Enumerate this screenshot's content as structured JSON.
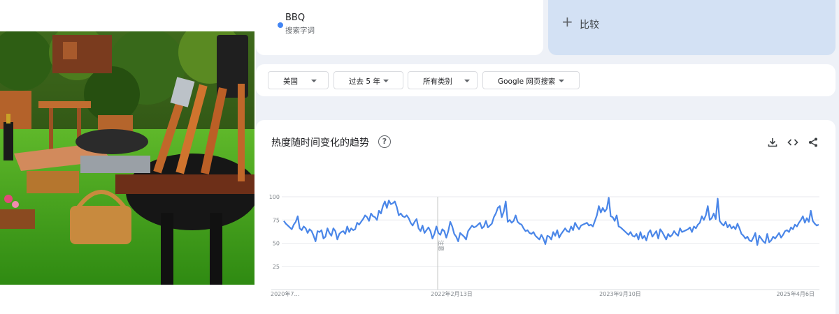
{
  "search_term": {
    "name": "BBQ",
    "type": "搜索字词",
    "color": "#4285f4"
  },
  "compare": {
    "label": "比较"
  },
  "filters": {
    "region": "美国",
    "time": "过去 5 年",
    "category": "所有类别",
    "search_type": "Google 网页搜索"
  },
  "chart_panel": {
    "title": "热度随时间变化的趋势",
    "help": "?",
    "note": "注意"
  },
  "chart_data": {
    "type": "line",
    "title": "热度随时间变化的趋势",
    "xlabel": "",
    "ylabel": "",
    "ylim": [
      0,
      100
    ],
    "y_ticks": [
      25,
      50,
      75,
      100
    ],
    "x_tick_labels": [
      "2020年7…",
      "2022年2月13日",
      "2023年9月10日",
      "2025年4月6日"
    ],
    "grid": true,
    "series": [
      {
        "name": "BBQ",
        "color": "#4a86e8",
        "values": [
          74,
          71,
          69,
          67,
          65,
          70,
          73,
          79,
          66,
          64,
          68,
          66,
          61,
          65,
          63,
          58,
          52,
          63,
          62,
          64,
          55,
          57,
          66,
          61,
          58,
          66,
          63,
          54,
          60,
          62,
          63,
          60,
          68,
          62,
          66,
          64,
          65,
          72,
          70,
          73,
          76,
          80,
          78,
          74,
          82,
          79,
          78,
          75,
          85,
          82,
          90,
          95,
          88,
          96,
          92,
          93,
          95,
          89,
          80,
          82,
          79,
          78,
          80,
          77,
          72,
          69,
          73,
          76,
          66,
          63,
          69,
          61,
          64,
          67,
          63,
          55,
          60,
          68,
          61,
          59,
          65,
          63,
          56,
          63,
          73,
          68,
          60,
          57,
          52,
          61,
          59,
          57,
          54,
          63,
          66,
          69,
          67,
          68,
          70,
          72,
          66,
          68,
          74,
          67,
          69,
          71,
          78,
          82,
          88,
          90,
          78,
          84,
          95,
          73,
          75,
          72,
          74,
          80,
          73,
          71,
          70,
          66,
          63,
          64,
          61,
          60,
          62,
          58,
          56,
          54,
          59,
          55,
          49,
          58,
          57,
          54,
          62,
          58,
          64,
          56,
          60,
          63,
          66,
          63,
          62,
          68,
          64,
          72,
          68,
          65,
          69,
          70,
          71,
          72,
          69,
          70,
          68,
          74,
          80,
          90,
          83,
          88,
          84,
          87,
          99,
          79,
          78,
          74,
          80,
          68,
          67,
          65,
          63,
          61,
          59,
          62,
          58,
          57,
          60,
          54,
          62,
          55,
          58,
          53,
          61,
          64,
          57,
          60,
          63,
          55,
          65,
          62,
          58,
          54,
          60,
          57,
          59,
          63,
          60,
          58,
          66,
          62,
          63,
          64,
          65,
          67,
          62,
          68,
          66,
          70,
          72,
          79,
          75,
          80,
          90,
          75,
          77,
          82,
          76,
          98,
          74,
          71,
          69,
          73,
          67,
          70,
          66,
          68,
          65,
          71,
          66,
          60,
          58,
          55,
          57,
          53,
          52,
          56,
          61,
          48,
          58,
          55,
          52,
          50,
          60,
          51,
          53,
          57,
          55,
          58,
          61,
          56,
          59,
          63,
          64,
          62,
          67,
          65,
          70,
          68,
          72,
          75,
          79,
          72,
          77,
          73,
          85,
          74,
          71,
          69,
          70
        ]
      }
    ]
  },
  "icons": {
    "download": "download-icon",
    "embed": "embed-code-icon",
    "share": "share-icon",
    "help": "help-icon"
  },
  "colors": {
    "accent": "#4285f4",
    "compare_bg": "#d3e1f4",
    "page_bg": "#eef1f7"
  }
}
